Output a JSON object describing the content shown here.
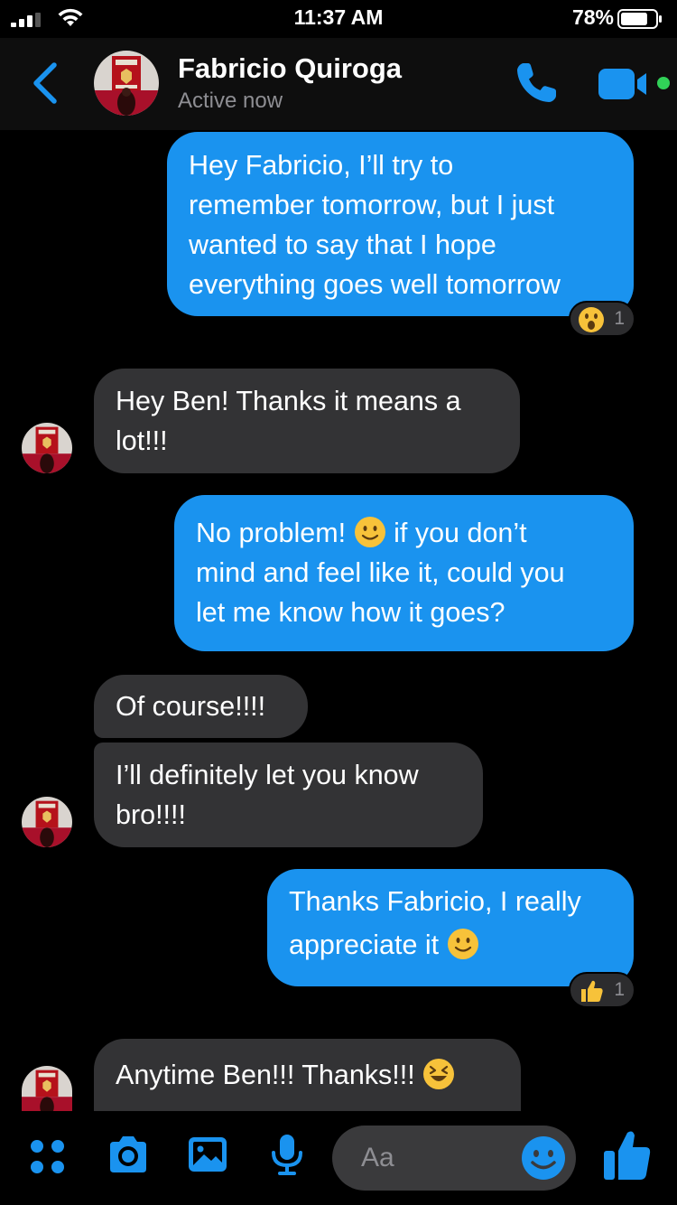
{
  "status_bar": {
    "time": "11:37 AM",
    "battery": "78%",
    "battery_level": 0.78
  },
  "header": {
    "contact_name": "Fabricio Quiroga",
    "contact_status": "Active now"
  },
  "messages": [
    {
      "direction": "sent",
      "lines": [
        "Hey Fabricio, I’ll try to",
        "remember tomorrow, but I just",
        "wanted to say that I hope",
        "everything goes well tomorrow"
      ],
      "reaction": {
        "emoji": "astonished-face-icon",
        "count": "1"
      }
    },
    {
      "direction": "received",
      "lines": [
        "Hey Ben! Thanks it means a",
        "lot!!!"
      ]
    },
    {
      "direction": "sent",
      "line1_before": "No problem!",
      "line1_after": "if you don’t",
      "lines_rest": [
        "mind and feel like it, could you",
        "let me know how it goes?"
      ]
    },
    {
      "direction": "received",
      "lines": [
        "Of course!!!!"
      ]
    },
    {
      "direction": "received",
      "lines": [
        "I’ll definitely let you know",
        "bro!!!!"
      ]
    },
    {
      "direction": "sent",
      "line1": "Thanks Fabricio, I really",
      "line2_before": "appreciate it",
      "reaction": {
        "emoji": "thumbs-up-icon",
        "count": "1"
      }
    },
    {
      "direction": "received",
      "text_before": "Anytime Ben!!! Thanks!!!"
    }
  ],
  "composer": {
    "placeholder": "Aa"
  },
  "colors": {
    "sent_bubble": "#1a93ef",
    "received_bubble": "#333335",
    "accent": "#1a93ef",
    "active_dot": "#31d158"
  }
}
